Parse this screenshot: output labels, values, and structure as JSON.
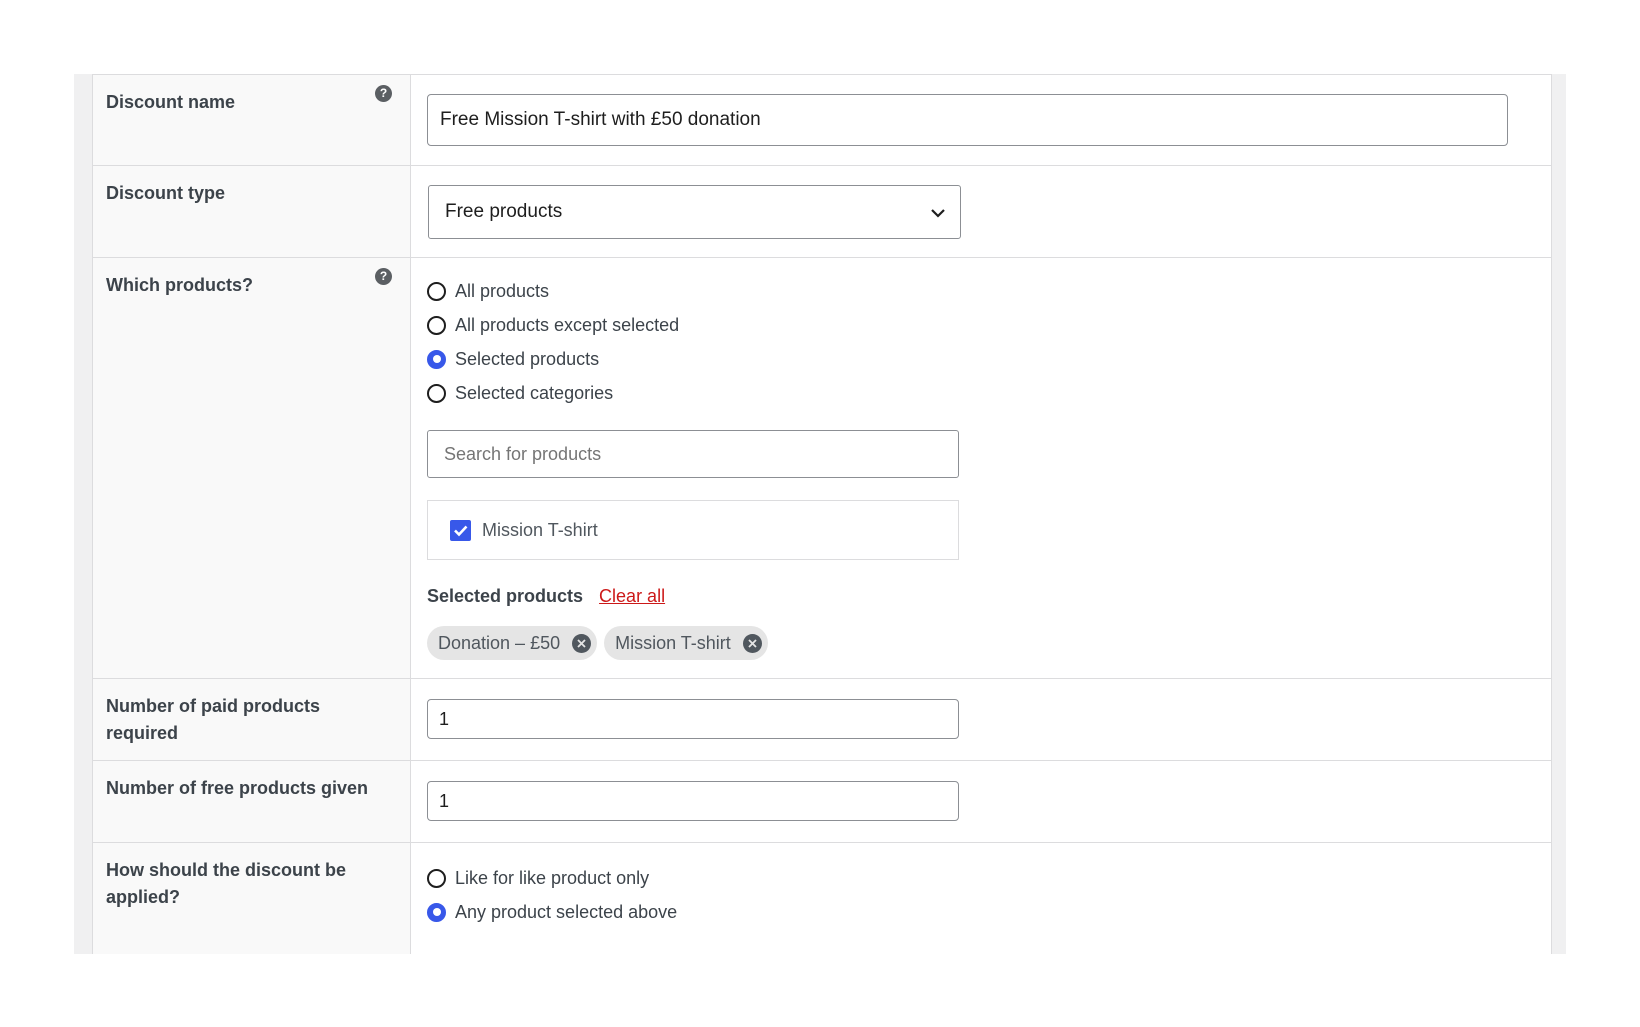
{
  "discount_name": {
    "label": "Discount name",
    "value": "Free Mission T-shirt with £50 donation",
    "help_icon": "question-circle-icon"
  },
  "discount_type": {
    "label": "Discount type",
    "selected": "Free products",
    "icon": "chevron-down-icon"
  },
  "which_products": {
    "label": "Which products?",
    "help_icon": "question-circle-icon",
    "options": [
      {
        "label": "All products",
        "checked": false
      },
      {
        "label": "All products except selected",
        "checked": false
      },
      {
        "label": "Selected products",
        "checked": true
      },
      {
        "label": "Selected categories",
        "checked": false
      }
    ],
    "search_placeholder": "Search for products",
    "search_result": {
      "label": "Mission T-shirt",
      "checked": true
    },
    "selected_heading": "Selected products",
    "clear_all": "Clear all",
    "selected_chips": [
      "Donation – £50",
      "Mission T-shirt"
    ]
  },
  "paid_required": {
    "label": "Number of paid products required",
    "value": "1"
  },
  "free_given": {
    "label": "Number of free products given",
    "value": "1"
  },
  "apply_mode": {
    "label": "How should the discount be applied?",
    "options": [
      {
        "label": "Like for like product only",
        "checked": false
      },
      {
        "label": "Any product selected above",
        "checked": true
      }
    ]
  },
  "colors": {
    "accent": "#3858e9",
    "link_red": "#cc1818",
    "label_bg": "#f9f9f9",
    "border": "#dcdcde"
  }
}
